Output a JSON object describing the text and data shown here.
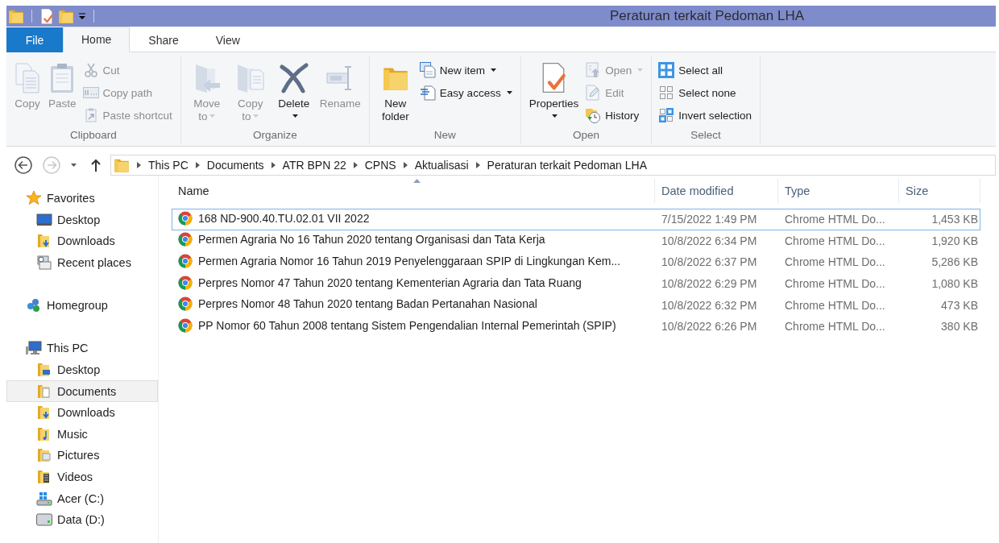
{
  "window": {
    "title": "Peraturan terkait Pedoman LHA"
  },
  "ribbon_tabs": [
    {
      "label": "File",
      "kind": "file",
      "selected": false
    },
    {
      "label": "Home",
      "kind": "tab",
      "selected": true
    },
    {
      "label": "Share",
      "kind": "tab",
      "selected": false
    },
    {
      "label": "View",
      "kind": "tab",
      "selected": false
    }
  ],
  "ribbon": {
    "groups": [
      {
        "label": "Clipboard",
        "items": [
          {
            "kind": "large",
            "label": "Copy",
            "disabled": true,
            "dropdown": false
          },
          {
            "kind": "large",
            "label": "Paste",
            "disabled": true,
            "dropdown": false
          },
          {
            "kind": "small",
            "label": "Cut",
            "disabled": true,
            "dropdown": false
          },
          {
            "kind": "small",
            "label": "Copy path",
            "disabled": true,
            "dropdown": false
          },
          {
            "kind": "small",
            "label": "Paste shortcut",
            "disabled": true,
            "dropdown": false
          }
        ]
      },
      {
        "label": "Organize",
        "items": [
          {
            "kind": "large",
            "label": "Move to",
            "disabled": true,
            "dropdown": true
          },
          {
            "kind": "large",
            "label": "Copy to",
            "disabled": true,
            "dropdown": true
          },
          {
            "kind": "large",
            "label": "Delete",
            "disabled": false,
            "dropdown": true
          },
          {
            "kind": "large",
            "label": "Rename",
            "disabled": true,
            "dropdown": false
          }
        ]
      },
      {
        "label": "New",
        "items": [
          {
            "kind": "large",
            "label": "New folder",
            "disabled": false,
            "dropdown": false
          },
          {
            "kind": "small",
            "label": "New item",
            "disabled": false,
            "dropdown": true
          },
          {
            "kind": "small",
            "label": "Easy access",
            "disabled": false,
            "dropdown": true
          }
        ]
      },
      {
        "label": "Open",
        "items": [
          {
            "kind": "large",
            "label": "Properties",
            "disabled": false,
            "dropdown": true
          },
          {
            "kind": "small",
            "label": "Open",
            "disabled": true,
            "dropdown": true
          },
          {
            "kind": "small",
            "label": "Edit",
            "disabled": true,
            "dropdown": false
          },
          {
            "kind": "small",
            "label": "History",
            "disabled": false,
            "dropdown": false
          }
        ]
      },
      {
        "label": "Select",
        "items": [
          {
            "kind": "small",
            "label": "Select all",
            "disabled": false,
            "dropdown": false
          },
          {
            "kind": "small",
            "label": "Select none",
            "disabled": false,
            "dropdown": false
          },
          {
            "kind": "small",
            "label": "Invert selection",
            "disabled": false,
            "dropdown": false
          }
        ]
      }
    ]
  },
  "address_bar": {
    "back": {
      "disabled": false
    },
    "forward": {
      "disabled": true
    },
    "path": [
      "This PC",
      "Documents",
      "ATR BPN 22",
      "CPNS",
      "Aktualisasi",
      "Peraturan terkait Pedoman LHA"
    ]
  },
  "navigation": [
    {
      "label": "Favorites",
      "selected": false,
      "children": [
        {
          "label": "Desktop",
          "selected": false
        },
        {
          "label": "Downloads",
          "selected": false
        },
        {
          "label": "Recent places",
          "selected": false
        }
      ]
    },
    {
      "label": "Homegroup",
      "selected": false
    },
    {
      "label": "This PC",
      "selected": false,
      "children": [
        {
          "label": "Desktop",
          "selected": false
        },
        {
          "label": "Documents",
          "selected": true
        },
        {
          "label": "Downloads",
          "selected": false
        },
        {
          "label": "Music",
          "selected": false
        },
        {
          "label": "Pictures",
          "selected": false
        },
        {
          "label": "Videos",
          "selected": false
        },
        {
          "label": "Acer (C:)",
          "selected": false
        },
        {
          "label": "Data (D:)",
          "selected": false
        }
      ]
    }
  ],
  "files": {
    "columns": [
      {
        "label": "Name",
        "sorted": true
      },
      {
        "label": "Date modified",
        "sorted": false
      },
      {
        "label": "Type",
        "sorted": false
      },
      {
        "label": "Size",
        "sorted": false
      }
    ],
    "rows": [
      {
        "name": "168 ND-900.40.TU.02.01 VII 2022",
        "date_modified": "7/15/2022 1:49 PM",
        "type": "Chrome HTML Do...",
        "size": "1,453 KB",
        "focused": true
      },
      {
        "name": "Permen Agraria No 16 Tahun 2020 tentang Organisasi dan Tata Kerja",
        "date_modified": "10/8/2022 6:34 PM",
        "type": "Chrome HTML Do...",
        "size": "1,920 KB",
        "focused": false
      },
      {
        "name": "Permen Agraria Nomor 16 Tahun 2019 Penyelenggaraan SPIP di Lingkungan Kem...",
        "date_modified": "10/8/2022 6:37 PM",
        "type": "Chrome HTML Do...",
        "size": "5,286 KB",
        "focused": false
      },
      {
        "name": "Perpres Nomor 47 Tahun 2020 tentang Kementerian Agraria dan Tata Ruang",
        "date_modified": "10/8/2022 6:29 PM",
        "type": "Chrome HTML Do...",
        "size": "1,080 KB",
        "focused": false
      },
      {
        "name": "Perpres Nomor 48 Tahun 2020 tentang Badan Pertanahan Nasional",
        "date_modified": "10/8/2022 6:32 PM",
        "type": "Chrome HTML Do...",
        "size": "473 KB",
        "focused": false
      },
      {
        "name": "PP Nomor 60 Tahun 2008 tentang Sistem Pengendalian Internal Pemerintah (SPIP)",
        "date_modified": "10/8/2022 6:26 PM",
        "type": "Chrome HTML Do...",
        "size": "380 KB",
        "focused": false
      }
    ]
  }
}
